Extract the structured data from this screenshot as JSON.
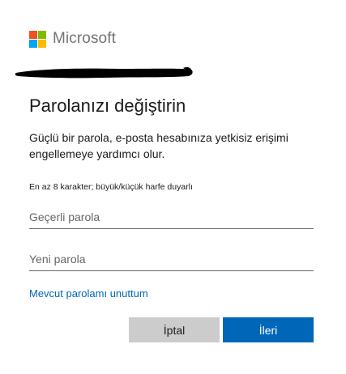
{
  "brand": {
    "name": "Microsoft",
    "logo_colors": [
      "#f25022",
      "#7fba00",
      "#00a4ef",
      "#ffb900"
    ]
  },
  "account": {
    "email_redacted": true
  },
  "page": {
    "title": "Parolanızı değiştirin",
    "description": "Güçlü bir parola, e-posta hesabınıza yetkisiz erişimi engellemeye yardımcı olur.",
    "hint": "En az 8 karakter; büyük/küçük harfe duyarlı"
  },
  "form": {
    "current_password": {
      "value": "",
      "placeholder": "Geçerli parola"
    },
    "new_password": {
      "value": "",
      "placeholder": "Yeni parola"
    },
    "forgot_link": "Mevcut parolamı unuttum"
  },
  "buttons": {
    "cancel": "İptal",
    "next": "İleri"
  },
  "colors": {
    "accent": "#0067b8",
    "secondary_button": "#cccccc",
    "text": "#1b1b1b"
  }
}
